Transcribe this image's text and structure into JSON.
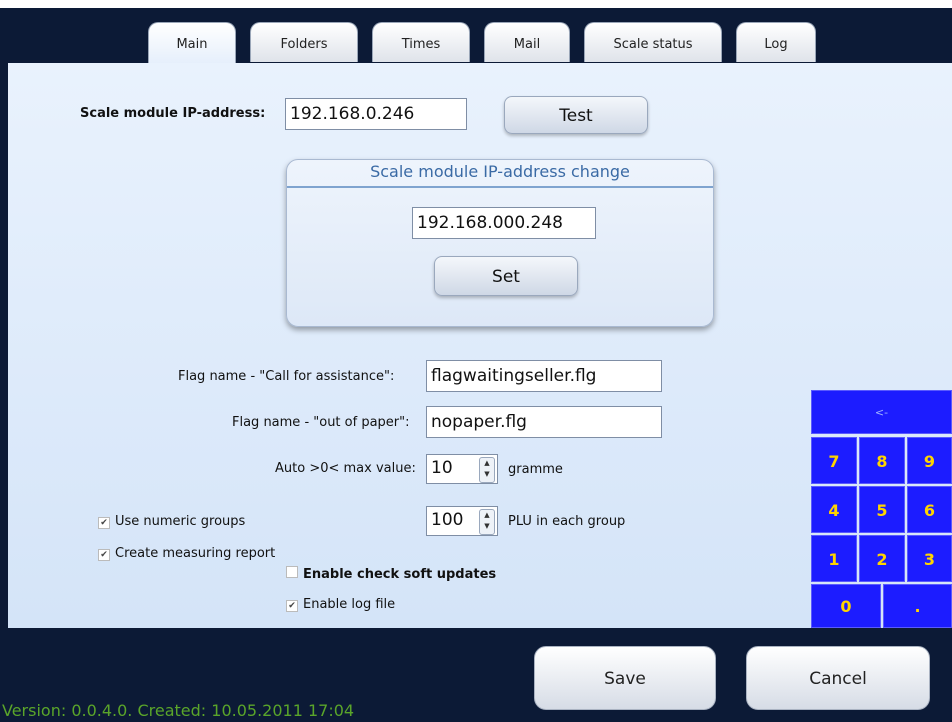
{
  "tabs": [
    {
      "label": "Main",
      "active": true
    },
    {
      "label": "Folders"
    },
    {
      "label": "Times"
    },
    {
      "label": "Mail"
    },
    {
      "label": "Scale status"
    },
    {
      "label": "Log"
    }
  ],
  "main": {
    "ip_label": "Scale module IP-address:",
    "ip_value": "192.168.0.246",
    "test_label": "Test",
    "ipchange": {
      "title": "Scale module IP-address change",
      "value": "192.168.000.248",
      "set_label": "Set"
    },
    "flag_assist_label": "Flag name - \"Call for assistance\":",
    "flag_assist_value": "flagwaitingseller.flg",
    "flag_paper_label": "Flag name - \"out of paper\":",
    "flag_paper_value": "nopaper.flg",
    "auto_label": "Auto >0< max value:",
    "auto_value": "10",
    "auto_unit": "gramme",
    "group_value": "100",
    "group_unit": "PLU in each group",
    "chk_numeric": {
      "label": "Use numeric groups",
      "checked": true
    },
    "chk_measuring": {
      "label": "Create measuring report",
      "checked": true
    },
    "chk_updates": {
      "label": "Enable check soft updates",
      "checked": false
    },
    "chk_log": {
      "label": "Enable log file",
      "checked": true
    }
  },
  "keypad": {
    "backspace": "<-",
    "keys": [
      "7",
      "8",
      "9",
      "4",
      "5",
      "6",
      "1",
      "2",
      "3"
    ],
    "zero": "0",
    "dot": "."
  },
  "footer": {
    "save_label": "Save",
    "cancel_label": "Cancel",
    "version": "Version: 0.0.4.0. Created: 10.05.2011 17:04"
  },
  "colors": {
    "background": "#0c1a36",
    "keypad": "#1c1cff",
    "keypad_text": "#ffd400",
    "version_text": "#5aa52a",
    "groupbox_title": "#3a6aa5"
  }
}
